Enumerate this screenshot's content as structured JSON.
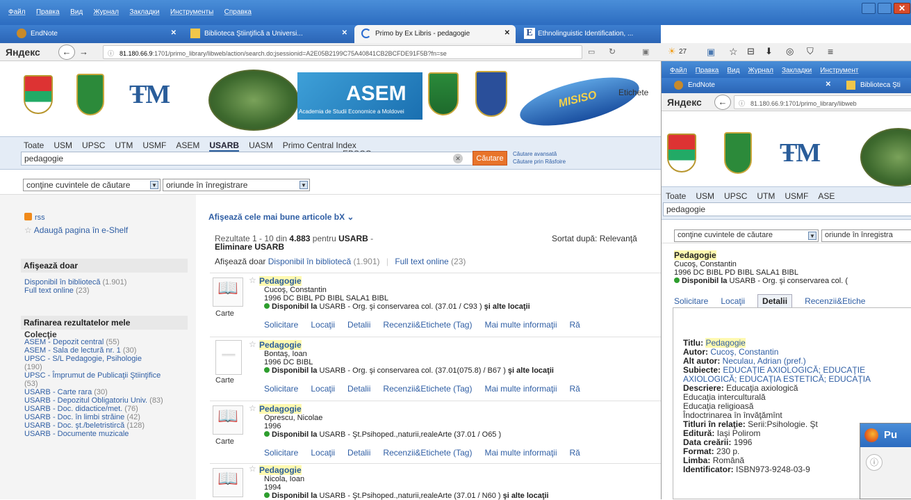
{
  "menu": [
    "Файл",
    "Правка",
    "Вид",
    "Журнал",
    "Закладки",
    "Инструменты",
    "Справка"
  ],
  "tabs": [
    {
      "label": "EndNote"
    },
    {
      "label": "Biblioteca Ştiinţifică a Universi..."
    },
    {
      "label": "Primo by Ex Libris - pedagogie"
    },
    {
      "label": "Ethnolinguistic Identification, ..."
    }
  ],
  "tab_new": "+",
  "browser": {
    "brand": "Яндекс",
    "url_host": "81.180.66.9",
    "url_rest": ":1701/primo_library/libweb/action/search.do;jsessionid=A2E05B2199C75A40841CB2BCFDE91F5B?fn=se",
    "weather": "27"
  },
  "logos": {
    "asem": "ASEM",
    "asem_sub": "Academia de Studii Economice a Moldovei",
    "misiso": "MISISO",
    "etichete": "Etichete"
  },
  "scopes": [
    "Toate",
    "USM",
    "UPSC",
    "UTM",
    "USMF",
    "ASEM",
    "USARB",
    "UASM",
    "Primo Central Index"
  ],
  "scope_extra": "EBSCO",
  "search": {
    "value": "pedagogie",
    "clear": "✕",
    "button": "Căutare",
    "adv": "Căutare avansată",
    "browse": "Căutare prin Răsfoire"
  },
  "filters": {
    "contains": "conţine cuvintele de căutare",
    "where": "oriunde în înregistrare"
  },
  "side": {
    "rss": "rss",
    "eshelf": "Adaugă pagina în e-Shelf",
    "show_only_h": "Afişează doar",
    "show_only": [
      {
        "label": "Disponibil în bibliotecă",
        "count": "(1.901)"
      },
      {
        "label": "Full text online",
        "count": "(23)"
      }
    ],
    "refine_h": "Rafinarea rezultatelor mele",
    "coll_h": "Colecţie",
    "colls": [
      {
        "label": "ASEM - Depozit central",
        "count": "(55)"
      },
      {
        "label": "ASEM - Sala de lectură nr. 1",
        "count": "(30)"
      },
      {
        "label": "UPSC - S/L Pedagogie, Psihologie",
        "count": "(190)"
      },
      {
        "label": "UPSC - Împrumut de Publicaţii Ştiinţifice",
        "count": "(53)"
      },
      {
        "label": "USARB - Carte rara",
        "count": "(30)"
      },
      {
        "label": "USARB - Depozitul Obligatoriu Univ.",
        "count": "(83)"
      },
      {
        "label": "USARB - Doc. didactice/met.",
        "count": "(76)"
      },
      {
        "label": "USARB - Doc. în limbi străine",
        "count": "(42)"
      },
      {
        "label": "USARB - Doc. şt./beletristircă",
        "count": "(128)"
      },
      {
        "label": "USARB - Documente muzicale",
        "count": ""
      }
    ]
  },
  "results": {
    "bx": "Afişează cele mai bune articole bX",
    "pre": "Rezultate 1 - 10 din ",
    "total": "4.883",
    "mid": " pentru ",
    "scope": "USARB",
    "dash": " -",
    "elim": "Eliminare USARB",
    "sorted": "Sortat după: Relevanţă",
    "show": "Afişează doar",
    "avail": "Disponibil în bibliotecă",
    "avail_c": "(1.901)",
    "ft": "Full text online",
    "ft_c": "(23)"
  },
  "records": [
    {
      "title": "Pedagogie",
      "author": "Cucoş, Constantin",
      "line": "1996 DC BIBL PD BIBL SALA1 BIBL",
      "avail_b": "Disponibil la",
      "avail": " USARB - Org. şi conservarea col.  (37.01 / C93 )",
      "more": " şi alte locaţii",
      "type": "Carte"
    },
    {
      "title": "Pedagogie",
      "author": "Bontaş, Ioan",
      "line": "1996 DC BIBL",
      "avail_b": "Disponibil la",
      "avail": " USARB - Org. şi conservarea col.  (37.01(075.8) / B67 )",
      "more": " şi alte locaţii",
      "type": "Carte"
    },
    {
      "title": "Pedagogie",
      "author": "Oprescu, Nicolae",
      "line": "1996",
      "avail_b": "Disponibil la",
      "avail": " USARB - Şt.Psihoped.,naturii,realeArte  (37.01 / O65 )",
      "more": "",
      "type": "Carte"
    },
    {
      "title": "Pedagogie",
      "author": "Nicola, Ioan",
      "line": "1994",
      "avail_b": "Disponibil la",
      "avail": " USARB - Şt.Psihoped.,naturii,realeArte  (37.01 / N60 )",
      "more": " şi alte locaţii",
      "type": ""
    }
  ],
  "rec_links": [
    "Solicitare",
    "Locaţii",
    "Detalii",
    "Recenzii&Etichete (Tag)",
    "Mai multe informaţii",
    "Ră"
  ],
  "second": {
    "menu": [
      "Файл",
      "Правка",
      "Вид",
      "Журнал",
      "Закладки",
      "Инструмент"
    ],
    "tab1": "EndNote",
    "tab2": "Biblioteca Şti",
    "brand": "Яндекс",
    "url": "81.180.66.9:1701/primo_library/libweb",
    "scopes": [
      "Toate",
      "USM",
      "UPSC",
      "UTM",
      "USMF",
      "ASE"
    ],
    "search": "pedagogie",
    "contains": "conţine cuvintele de căutare",
    "where": "oriunde în înregistra",
    "title": "Pedagogie",
    "author": "Cucoş, Constantin",
    "line": "1996 DC BIBL PD BIBL SALA1 BIBL",
    "avail_b": "Disponibil la",
    "avail": " USARB - Org. şi conservarea col.  (",
    "tabs": [
      "Solicitare",
      "Locaţii",
      "Detalii",
      "Recenzii&Etiche"
    ],
    "details": [
      {
        "k": "Titlu:",
        "v": "Pedagogie"
      },
      {
        "k": "Autor:",
        "v": "Cucoş, Constantin"
      },
      {
        "k": "Alt autor:",
        "v": "Neculau, Adrian (pref.)"
      },
      {
        "k": "Subiecte:",
        "v": "EDUCAŢIE AXIOLOGICĂ; EDUCAŢIE AXIOLOGICĂ; EDUCAŢIA ESTETICĂ; EDUCAŢIA"
      },
      {
        "k": "Descriere:",
        "v": "Educaţia axiologică"
      }
    ],
    "desc_more": [
      "Educaţia interculturală",
      "Educaţia religioasă",
      "Îndoctrinarea în învăţămînt"
    ],
    "details2": [
      {
        "k": "Titluri în relaţie:",
        "v": "Serii:Psihologie. Şt"
      },
      {
        "k": "Editură:",
        "v": "Iaşi Polirom"
      },
      {
        "k": "Data creării:",
        "v": "1996"
      },
      {
        "k": "Format:",
        "v": "230 p."
      },
      {
        "k": "Limba:",
        "v": "Română"
      },
      {
        "k": "Identificator:",
        "v": "ISBN973-9248-03-9"
      }
    ],
    "popup": "Pu"
  }
}
